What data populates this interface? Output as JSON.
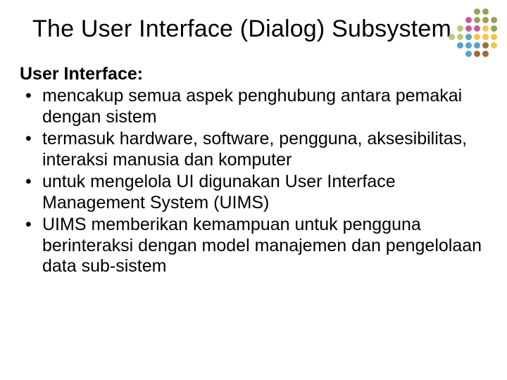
{
  "title": "The User Interface (Dialog) Subsystem",
  "subhead": "User Interface:",
  "bullets": [
    "mencakup semua aspek penghubung antara pemakai dengan sistem",
    "termasuk hardware, software, pengguna, aksesibilitas, interaksi manusia dan komputer",
    "untuk mengelola UI digunakan User Interface Management System (UIMS)",
    "UIMS memberikan kemampuan untuk pengguna berinteraksi dengan model manajemen dan pengelolaan data sub-sistem"
  ],
  "motif_colors": [
    [
      "",
      "",
      "",
      "#9aa05a",
      "#9aa05a",
      ""
    ],
    [
      "",
      "",
      "#c75a9e",
      "#9aa05a",
      "#9aa05a",
      "#9aa05a"
    ],
    [
      "",
      "#b9c97a",
      "#c75a9e",
      "#c75a9e",
      "#f3c54b",
      "#9aa05a"
    ],
    [
      "#b9c97a",
      "#b9c97a",
      "#5aa0c7",
      "#f3c54b",
      "#f3c54b",
      "#f3c54b"
    ],
    [
      "",
      "#5aa0c7",
      "#5aa0c7",
      "#5aa0c7",
      "#9e6b3c",
      "#f3c54b"
    ],
    [
      "",
      "",
      "#5aa0c7",
      "#9e6b3c",
      "#9e6b3c",
      ""
    ]
  ]
}
